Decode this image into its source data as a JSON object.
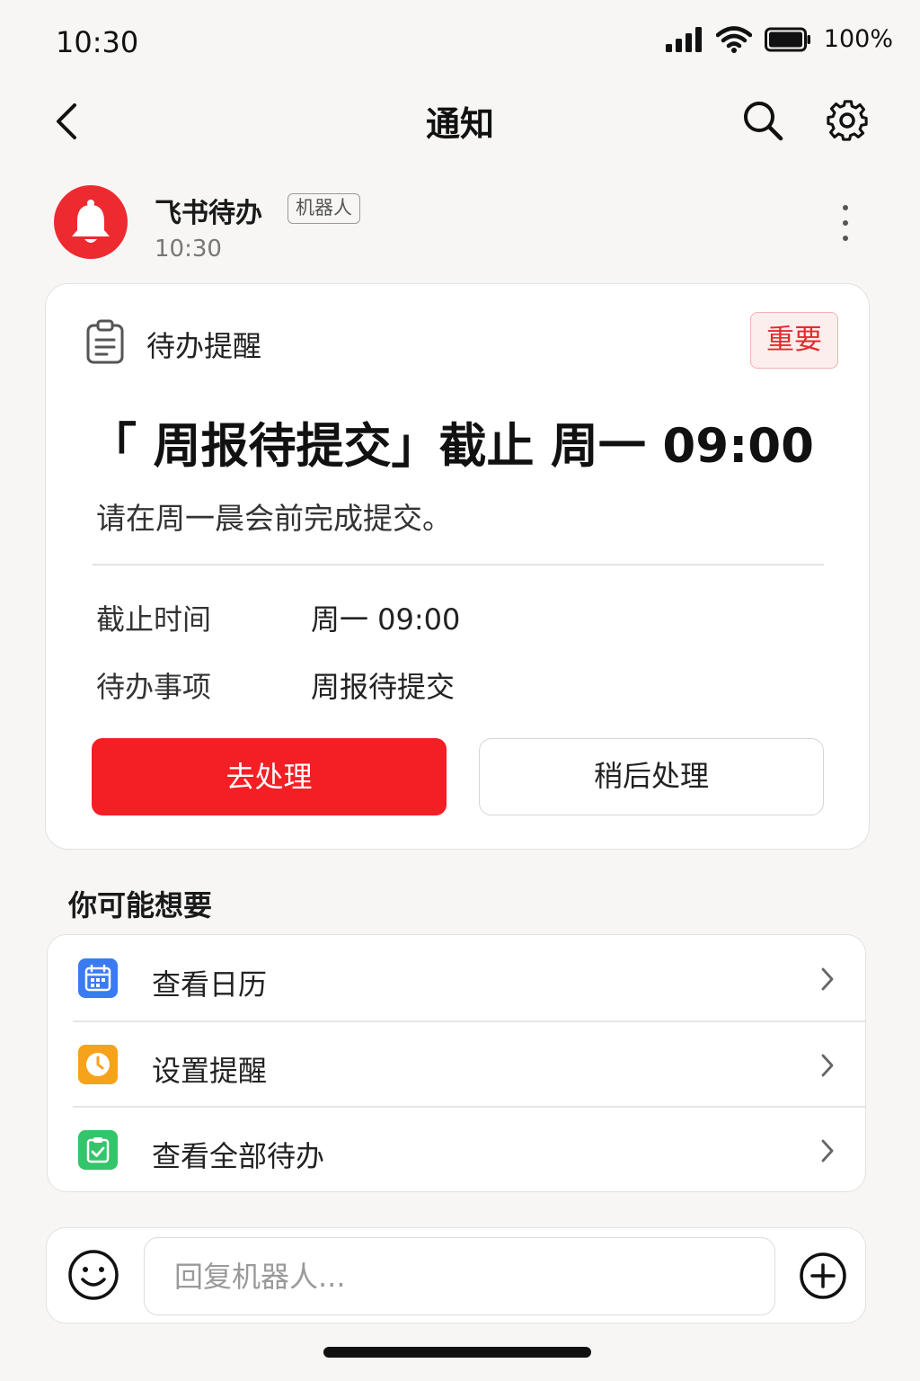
{
  "status_bar": {
    "time": "10:30",
    "battery": "100%"
  },
  "nav": {
    "title": "通知"
  },
  "sender": {
    "name": "飞书待办",
    "badge": "机器人",
    "time": "10:30"
  },
  "card": {
    "header_title": "待办提醒",
    "badge": "重要",
    "title": "「 周报待提交」截止 周一 09:00",
    "description": "请在周一晨会前完成提交。",
    "details": [
      {
        "label": "截止时间",
        "value": "周一 09:00"
      },
      {
        "label": "待办事项",
        "value": "周报待提交"
      }
    ],
    "primary_button": "去处理",
    "secondary_button": "稍后处理"
  },
  "suggestions": {
    "title": "你可能想要",
    "items": [
      {
        "label": "查看日历",
        "icon": "calendar-icon",
        "color": "#3a7bf2"
      },
      {
        "label": "设置提醒",
        "icon": "clock-icon",
        "color": "#f7a21b"
      },
      {
        "label": "查看全部待办",
        "icon": "todo-check-icon",
        "color": "#34c46a"
      }
    ]
  },
  "reply": {
    "placeholder": "回复机器人..."
  },
  "colors": {
    "accent": "#f31f24",
    "avatar": "#ee2a31",
    "badge_text": "#e52a2f"
  }
}
